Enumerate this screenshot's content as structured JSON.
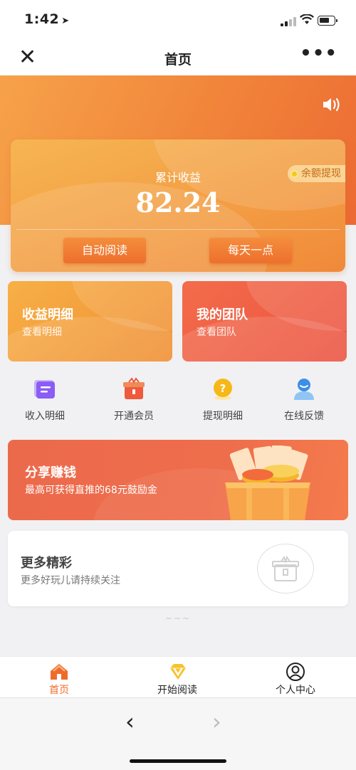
{
  "status": {
    "time": "1:42"
  },
  "navbar": {
    "title": "首页"
  },
  "earnings": {
    "label": "累计收益",
    "value": "82.24",
    "withdraw": "余额提现",
    "auto_read": "自动阅读",
    "daily_tip": "每天一点"
  },
  "cards": [
    {
      "title": "收益明细",
      "sub": "查看明细"
    },
    {
      "title": "我的团队",
      "sub": "查看团队"
    }
  ],
  "quick": [
    {
      "label": "收入明细",
      "icon": "note-icon",
      "color": "#8b5cf6"
    },
    {
      "label": "开通会员",
      "icon": "gift-box-icon",
      "color": "#ee5a3c"
    },
    {
      "label": "提现明细",
      "icon": "question-coin-icon",
      "color": "#f6b818"
    },
    {
      "label": "在线反馈",
      "icon": "user-icon",
      "color": "#3b8fe8"
    }
  ],
  "share": {
    "title": "分享赚钱",
    "sub": "最高可获得直推的68元鼓励金"
  },
  "more": {
    "title": "更多精彩",
    "sub": "更多好玩儿请持续关注"
  },
  "tabs": [
    {
      "label": "首页",
      "icon": "home-icon",
      "active": true
    },
    {
      "label": "开始阅读",
      "icon": "v-badge-icon",
      "active": false
    },
    {
      "label": "个人中心",
      "icon": "profile-icon",
      "active": false
    }
  ],
  "colors": {
    "accent": "#ef6b2a",
    "hero": "#f1843a",
    "team": "#eb5340"
  }
}
